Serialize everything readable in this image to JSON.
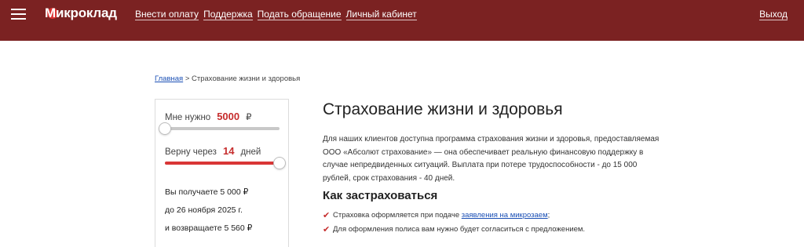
{
  "header": {
    "logo": "Микроклад",
    "nav": [
      "Внести оплату",
      "Поддержка",
      "Подать обращение",
      "Личный кабинет"
    ],
    "logout": "Выход",
    "background_color": "#7b2222",
    "menu_icon": "hamburger-icon"
  },
  "breadcrumb": {
    "home": "Главная",
    "separator": ">",
    "current": "Страхование жизни и здоровья"
  },
  "calculator": {
    "amount_label": "Мне нужно",
    "amount_value": "5000",
    "amount_currency": "₽",
    "amount_slider_fraction": 0.0,
    "term_label": "Верну через",
    "term_value": "14",
    "term_unit": "дней",
    "term_slider_fraction": 1.0,
    "receive_text": "Вы получаете 5 000 ₽",
    "date_text": "до 26 ноября 2025 г.",
    "return_text": "и возвращаете 5 560 ₽",
    "accent_color": "#d93636"
  },
  "main": {
    "title": "Страхование жизни и здоровья",
    "paragraph": "Для наших клиентов доступна программа страхования жизни и здоровья, предоставляемая ООО «Абсолют страхование» — она обеспечивает реальную финансовую поддержку в случае непредвиденных ситуаций. Выплата при потере трудоспособности - до 15 000 рублей, срок страхования - 40 дней.",
    "subtitle": "Как застраховаться",
    "list": {
      "item1_prefix": "Страховка оформляется при подаче ",
      "item1_link": "заявления на микрозаем",
      "item1_suffix": ";",
      "item2": "Для оформления полиса вам нужно будет согласиться с предложением."
    },
    "check_icon": "checkmark-icon"
  }
}
